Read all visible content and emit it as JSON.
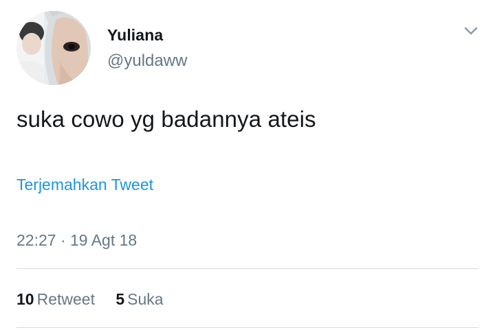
{
  "tweet": {
    "author": {
      "name": "Yuliana",
      "handle": "@yuldaww"
    },
    "text": "suka cowo yg badannya ateis",
    "translate_label": "Terjemahkan Tweet",
    "timestamp": "22:27 · 19 Agt 18",
    "stats": {
      "retweets_count": "10",
      "retweets_label": "Retweet",
      "likes_count": "5",
      "likes_label": "Suka"
    }
  },
  "icons": {
    "menu": "chevron-down-icon"
  },
  "colors": {
    "text_primary": "#14171a",
    "text_secondary": "#657786",
    "link": "#1b95e0",
    "divider": "#d6dbdf"
  }
}
